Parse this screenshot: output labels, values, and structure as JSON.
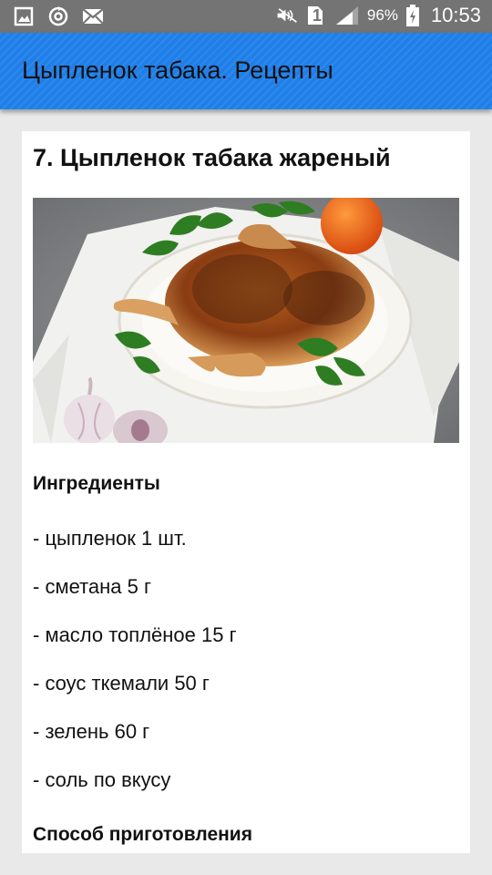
{
  "status_bar": {
    "battery": "96%",
    "time": "10:53",
    "sim": "1",
    "icons": [
      "image-icon",
      "sync-icon",
      "mail-icon",
      "mute-icon",
      "sim-icon",
      "signal-icon",
      "battery-icon"
    ]
  },
  "app_bar": {
    "title": "Цыпленок табака. Рецепты"
  },
  "recipe": {
    "title": "7. Цыпленок табака жареный",
    "photo": "roast-chicken-photo",
    "ingredients_heading": "Ингредиенты",
    "ingredients": [
      "- цыпленок 1 шт.",
      "- сметана 5 г",
      "- масло топлёное 15 г",
      "- соус ткемали 50 г",
      "- зелень 60 г",
      "- соль по вкусу"
    ],
    "method_heading": "Способ приготовления"
  },
  "colors": {
    "status_bar": "#747474",
    "app_bar": "#1f7fe8",
    "background": "#e9e9e9",
    "card": "#ffffff"
  }
}
